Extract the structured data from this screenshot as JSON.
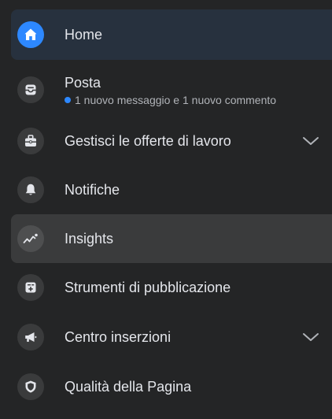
{
  "menu": {
    "items": [
      {
        "label": "Home",
        "icon": "home-icon",
        "state": "active"
      },
      {
        "label": "Posta",
        "icon": "inbox-icon",
        "sub_text": "1 nuovo messaggio e 1 nuovo commento"
      },
      {
        "label": "Gestisci le offerte di lavoro",
        "icon": "briefcase-icon",
        "expandable": true
      },
      {
        "label": "Notifiche",
        "icon": "bell-icon"
      },
      {
        "label": "Insights",
        "icon": "insights-icon",
        "state": "hover"
      },
      {
        "label": "Strumenti di pubblicazione",
        "icon": "publishing-tools-icon"
      },
      {
        "label": "Centro inserzioni",
        "icon": "megaphone-icon",
        "expandable": true
      },
      {
        "label": "Qualità della Pagina",
        "icon": "shield-icon"
      }
    ]
  },
  "colors": {
    "background": "#242526",
    "active_row": "#27313e",
    "hover_row": "#3a3b3c",
    "accent": "#2d88ff",
    "text": "#e4e6eb",
    "secondary_text": "#b0b3b8"
  }
}
